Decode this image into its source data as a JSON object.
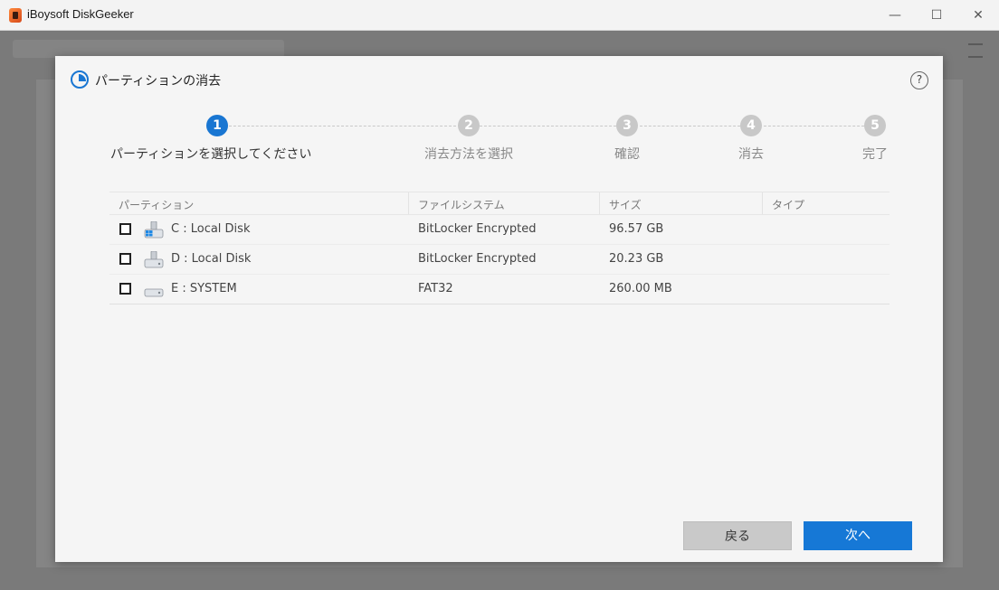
{
  "window": {
    "title": "iBoysoft DiskGeeker",
    "minimize": "—",
    "maximize": "☐",
    "close": "✕"
  },
  "dialog": {
    "title": "パーティションの消去",
    "help": "?",
    "accent_color": "#1976d2"
  },
  "steps": [
    {
      "number": "1",
      "label": "パーティションを選択してください",
      "active": true
    },
    {
      "number": "2",
      "label": "消去方法を選択",
      "active": false
    },
    {
      "number": "3",
      "label": "確認",
      "active": false
    },
    {
      "number": "4",
      "label": "消去",
      "active": false
    },
    {
      "number": "5",
      "label": "完了",
      "active": false
    }
  ],
  "table": {
    "headers": [
      "パーティション",
      "ファイルシステム",
      "サイズ",
      "タイプ"
    ],
    "rows": [
      {
        "name": "C : Local Disk",
        "filesystem": "BitLocker Encrypted",
        "size": "96.57 GB",
        "type": "",
        "icon": "windows-drive-icon",
        "checked": false
      },
      {
        "name": "D : Local Disk",
        "filesystem": "BitLocker Encrypted",
        "size": "20.23 GB",
        "type": "",
        "icon": "drive-icon",
        "checked": false
      },
      {
        "name": "E : SYSTEM",
        "filesystem": "FAT32",
        "size": "260.00 MB",
        "type": "",
        "icon": "small-drive-icon",
        "checked": false
      }
    ]
  },
  "buttons": {
    "back": "戻る",
    "next": "次へ"
  }
}
